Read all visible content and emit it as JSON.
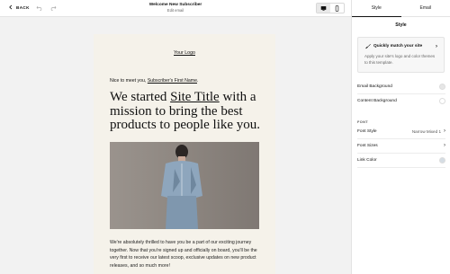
{
  "topbar": {
    "back_label": "BACK",
    "title": "Welcome New Subscriber",
    "subtitle": "Edit email"
  },
  "email": {
    "logo": "Your Logo",
    "greeting_prefix": "Nice to meet you, ",
    "greeting_name": "Subscriber's First Name",
    "greeting_suffix": ".",
    "headline_prefix": "We started ",
    "headline_link": "Site Title",
    "headline_suffix": " with a mission to bring the best products to people like you.",
    "body": "We're absolutely thrilled to have you be a part of our exciting journey together. Now that you're signed up and officially on board, you'll be the very first to receive our latest scoop, exclusive updates on new product releases, and so much more!"
  },
  "panel": {
    "tabs": [
      "Style",
      "Email"
    ],
    "active_tab": "Style",
    "title": "Style",
    "quick_match": {
      "title": "Quickly match your site",
      "desc": "Apply your site's logo and color themes to this template."
    },
    "rows": {
      "email_background": "Email Background",
      "content_background": "Content Background",
      "font_section": "FONT",
      "font_style": "Font Style",
      "font_style_value": "Narrow Mixed 1",
      "font_sizes": "Font Sizes",
      "link_color": "Link Color"
    },
    "colors": {
      "email_background": "#e6e6e6",
      "content_background": "#ffffff",
      "link_color": "#d5dde4"
    }
  }
}
